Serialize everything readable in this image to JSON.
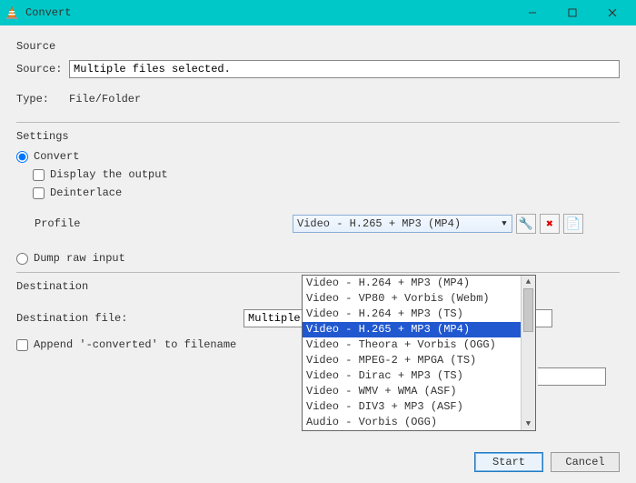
{
  "window": {
    "title": "Convert"
  },
  "source": {
    "section_label": "Source",
    "source_label": "Source:",
    "source_value": "Multiple files selected.",
    "type_label": "Type:",
    "type_value": "File/Folder"
  },
  "settings": {
    "section_label": "Settings",
    "convert_label": "Convert",
    "display_output_label": "Display the output",
    "deinterlace_label": "Deinterlace",
    "profile_label": "Profile",
    "profile_selected": "Video - H.265 + MP3 (MP4)",
    "profile_options": [
      "Video - H.264 + MP3 (MP4)",
      "Video - VP80 + Vorbis (Webm)",
      "Video - H.264 + MP3 (TS)",
      "Video - H.265 + MP3 (MP4)",
      "Video - Theora + Vorbis (OGG)",
      "Video - MPEG-2 + MPGA (TS)",
      "Video - Dirac + MP3 (TS)",
      "Video - WMV + WMA (ASF)",
      "Video - DIV3 + MP3 (ASF)",
      "Audio - Vorbis (OGG)"
    ],
    "dump_raw_label": "Dump raw input"
  },
  "destination": {
    "section_label": "Destination",
    "dest_file_label": "Destination file:",
    "dest_value": "Multiple Fil",
    "append_label": "Append '-converted' to filename"
  },
  "buttons": {
    "start": "Start",
    "cancel": "Cancel"
  },
  "icons": {
    "wrench": "🔧",
    "delete_x": "✖",
    "new_profile": "📄"
  }
}
